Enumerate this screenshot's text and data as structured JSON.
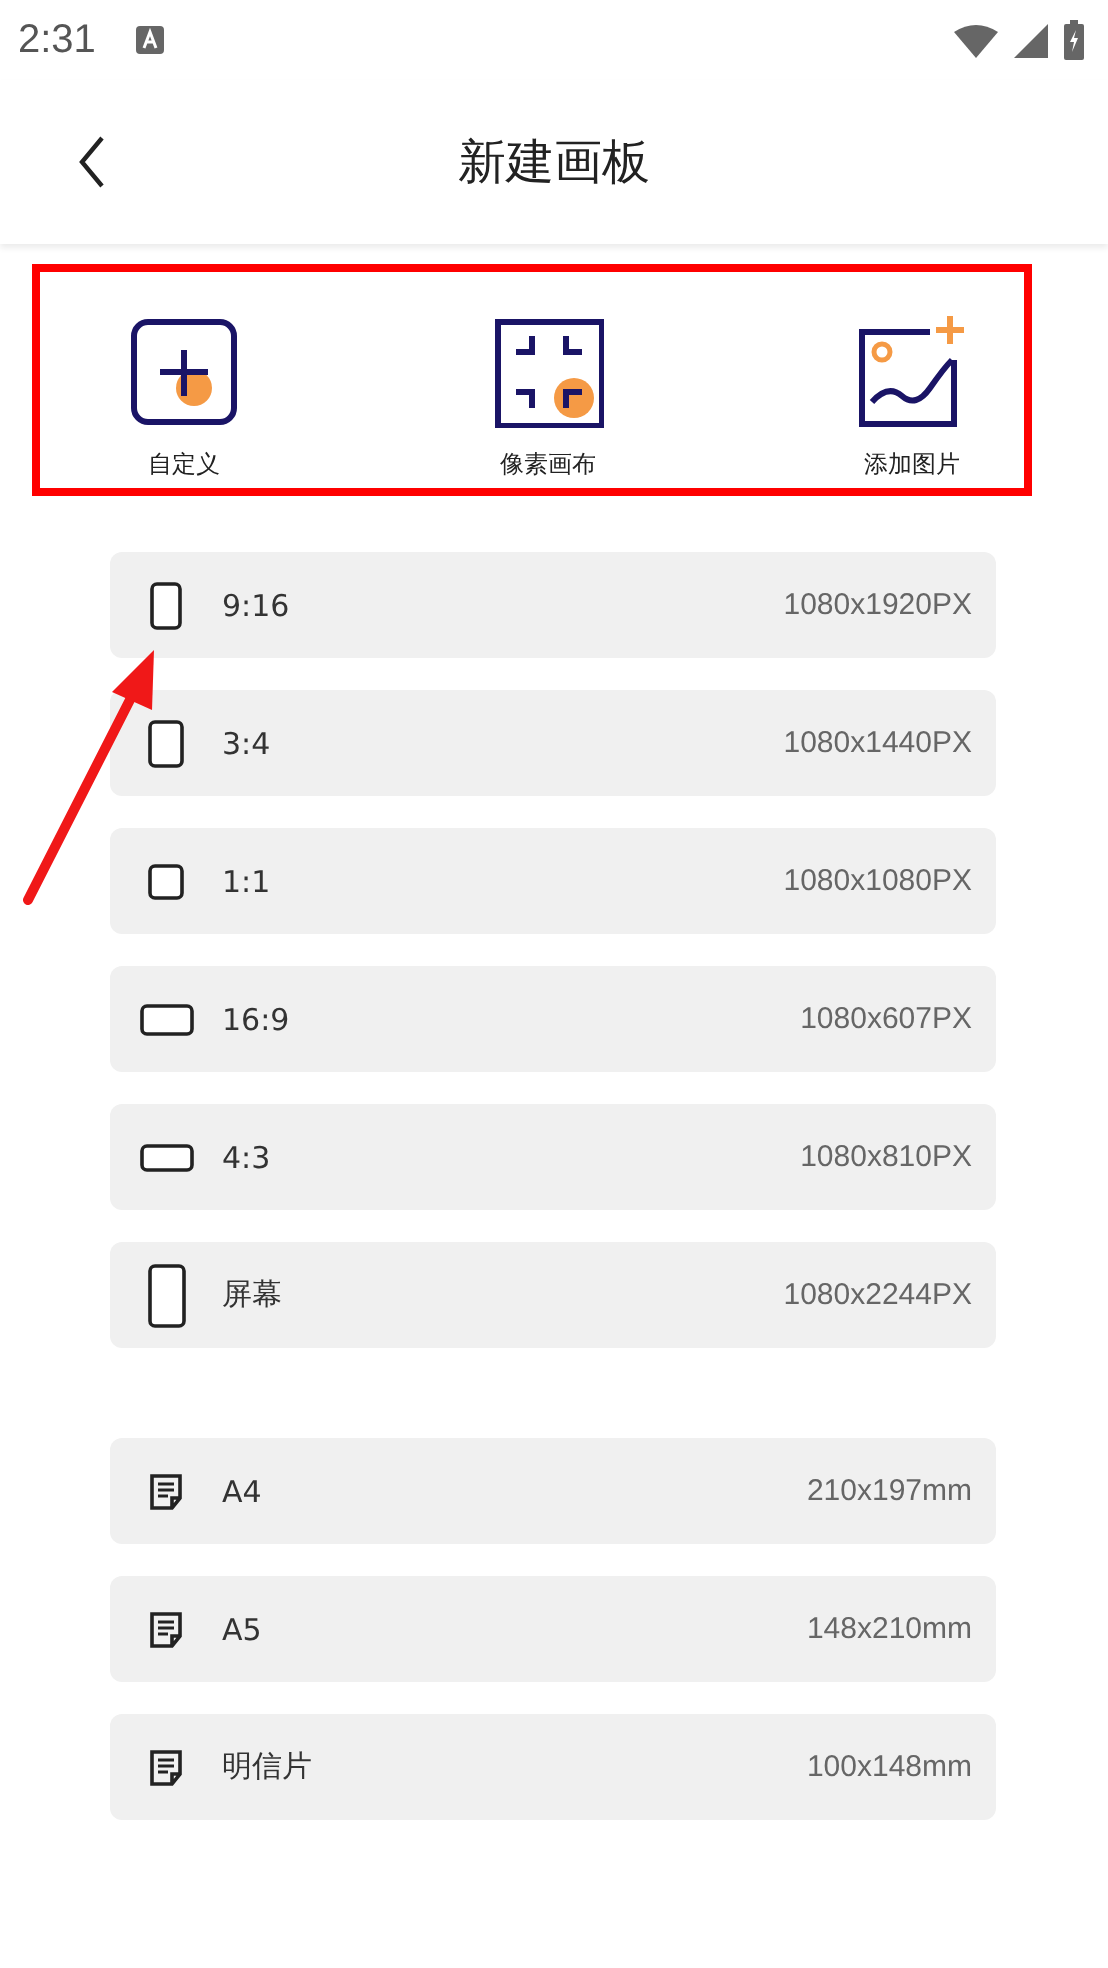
{
  "status_bar": {
    "time": "2:31"
  },
  "app_bar": {
    "title": "新建画板"
  },
  "quick_actions": [
    {
      "kind": "custom",
      "label": "自定义"
    },
    {
      "kind": "pixel",
      "label": "像素画布"
    },
    {
      "kind": "image",
      "label": "添加图片"
    }
  ],
  "screen_sizes": [
    {
      "kind": "tall",
      "label": "9:16",
      "size": "1080x1920PX"
    },
    {
      "kind": "portrait",
      "label": "3:4",
      "size": "1080x1440PX"
    },
    {
      "kind": "square",
      "label": "1:1",
      "size": "1080x1080PX"
    },
    {
      "kind": "wide",
      "label": "16:9",
      "size": "1080x607PX"
    },
    {
      "kind": "landscape",
      "label": "4:3",
      "size": "1080x810PX"
    },
    {
      "kind": "phone",
      "label": "屏幕",
      "size": "1080x2244PX"
    }
  ],
  "paper_sizes": [
    {
      "kind": "paper",
      "label": "A4",
      "size": "210x197mm"
    },
    {
      "kind": "paper",
      "label": "A5",
      "size": "148x210mm"
    },
    {
      "kind": "paper",
      "label": "明信片",
      "size": "100x148mm"
    }
  ]
}
